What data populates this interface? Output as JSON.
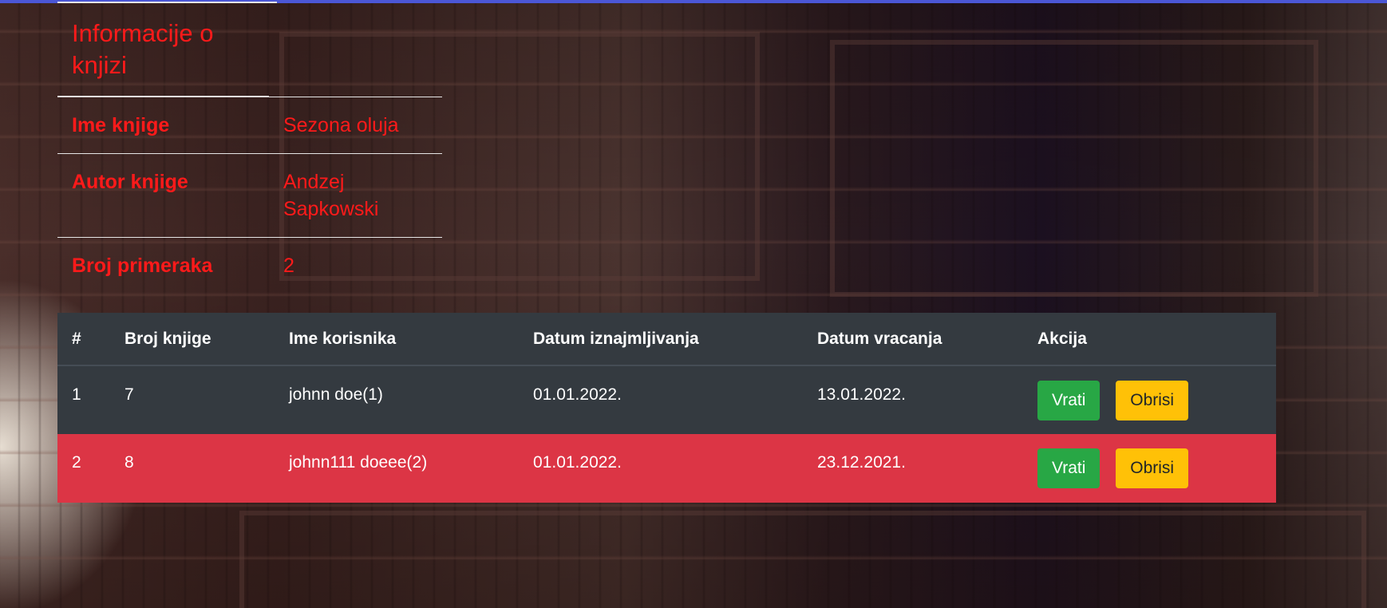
{
  "colors": {
    "topbar": "#4b57d6",
    "info_text": "#ff1a1a",
    "table_dark": "#343a40",
    "table_danger": "#dc3545",
    "btn_success": "#28a745",
    "btn_warning": "#ffc107"
  },
  "book_info": {
    "heading": "Informacije o knjizi",
    "fields": [
      {
        "label": "Ime knjige",
        "value": "Sezona oluja"
      },
      {
        "label": "Autor knjige",
        "value": "Andzej Sapkowski"
      },
      {
        "label": "Broj primeraka",
        "value": "2"
      }
    ]
  },
  "loans": {
    "headers": {
      "num": "#",
      "book_number": "Broj knjige",
      "user_name": "Ime korisnika",
      "date_lent": "Datum iznajmljivanja",
      "date_returned": "Datum vracanja",
      "action": "Akcija"
    },
    "rows": [
      {
        "num": "1",
        "book_number": "7",
        "user_name": "johnn doe(1)",
        "date_lent": "01.01.2022.",
        "date_returned": "13.01.2022.",
        "status": "dark",
        "return_label": "Vrati",
        "delete_label": "Obrisi"
      },
      {
        "num": "2",
        "book_number": "8",
        "user_name": "johnn111 doeee(2)",
        "date_lent": "01.01.2022.",
        "date_returned": "23.12.2021.",
        "status": "danger",
        "return_label": "Vrati",
        "delete_label": "Obrisi"
      }
    ]
  }
}
